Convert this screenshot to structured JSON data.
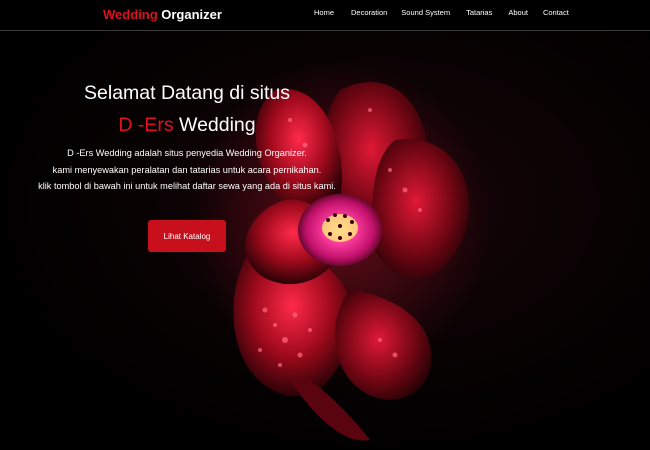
{
  "navbar": {
    "brand_part1": "Wedding",
    "brand_part2": "Organizer",
    "links": [
      "Home",
      "Decoration",
      "Sound System",
      "Tatarias",
      "About",
      "Contact"
    ]
  },
  "hero": {
    "title_line1": "Selamat Datang di situs",
    "title_line2_red": "D -Ers",
    "title_line2_white": "Wedding",
    "description_lines": [
      "D -Ers Wedding adalah situs penyedia Wedding Organizer.",
      "kami menyewakan peralatan dan tatarias untuk acara pernikahan.",
      "klik tombol di bawah ini untuk melihat daftar sewa yang ada di situs kami."
    ],
    "cta_label": "Lihat Katalog"
  },
  "colors": {
    "accent": "#e01020",
    "button": "#c8101c",
    "background": "#000000"
  },
  "hero_image": "red-flower-with-water-drops"
}
